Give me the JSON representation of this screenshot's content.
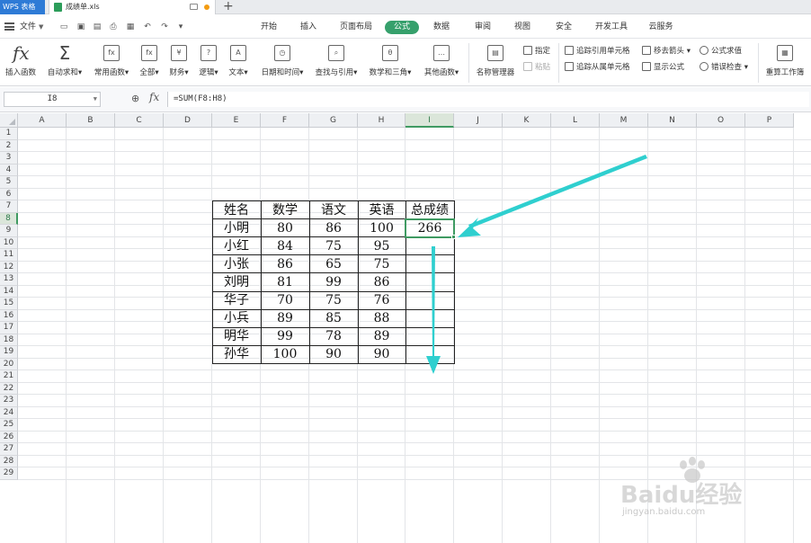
{
  "titlebar": {
    "app_label": "WPS 表格",
    "file_name": "成绩单.xls",
    "new_tab": "+"
  },
  "menubar": {
    "file_label": "文件",
    "tabs": [
      "开始",
      "插入",
      "页面布局",
      "公式",
      "数据",
      "审阅",
      "视图",
      "安全",
      "开发工具",
      "云服务"
    ],
    "active_tab": "公式"
  },
  "ribbon": {
    "buttons": [
      "插入函数",
      "自动求和",
      "常用函数",
      "全部",
      "财务",
      "逻辑",
      "文本",
      "日期和时间",
      "查找与引用",
      "数学和三角",
      "其他函数",
      "名称管理器"
    ],
    "small_buttons": [
      "指定",
      "粘贴",
      "追踪引用单元格",
      "追踪从属单元格",
      "移去箭头",
      "显示公式",
      "公式求值",
      "错误检查",
      "重算工作簿"
    ]
  },
  "formula_bar": {
    "cell_ref": "I8",
    "fx": "fx",
    "formula": "=SUM(F8:H8)"
  },
  "grid": {
    "columns": [
      "A",
      "B",
      "C",
      "D",
      "E",
      "F",
      "G",
      "H",
      "I",
      "J",
      "K",
      "L",
      "M",
      "N",
      "O",
      "P"
    ],
    "rows": [
      "1",
      "2",
      "3",
      "4",
      "5",
      "6",
      "7",
      "8",
      "9",
      "10",
      "11",
      "12",
      "13",
      "14",
      "15",
      "16",
      "17",
      "18",
      "19",
      "20",
      "21",
      "22",
      "23",
      "24",
      "25",
      "26",
      "27",
      "28",
      "29"
    ],
    "selected_column": "I",
    "selected_row": "8"
  },
  "table": {
    "headers": [
      "姓名",
      "数学",
      "语文",
      "英语",
      "总成绩"
    ],
    "rows": [
      [
        "小明",
        "80",
        "86",
        "100",
        "266"
      ],
      [
        "小红",
        "84",
        "75",
        "95",
        ""
      ],
      [
        "小张",
        "86",
        "65",
        "75",
        ""
      ],
      [
        "刘明",
        "81",
        "99",
        "86",
        ""
      ],
      [
        "华子",
        "70",
        "75",
        "76",
        ""
      ],
      [
        "小兵",
        "89",
        "85",
        "88",
        ""
      ],
      [
        "明华",
        "99",
        "78",
        "89",
        ""
      ],
      [
        "孙华",
        "100",
        "90",
        "90",
        ""
      ]
    ]
  },
  "annotations": {
    "arrow_color": "#2fcfcf"
  },
  "watermark": {
    "main": "Baidu经验",
    "sub": "jingyan.baidu.com"
  }
}
